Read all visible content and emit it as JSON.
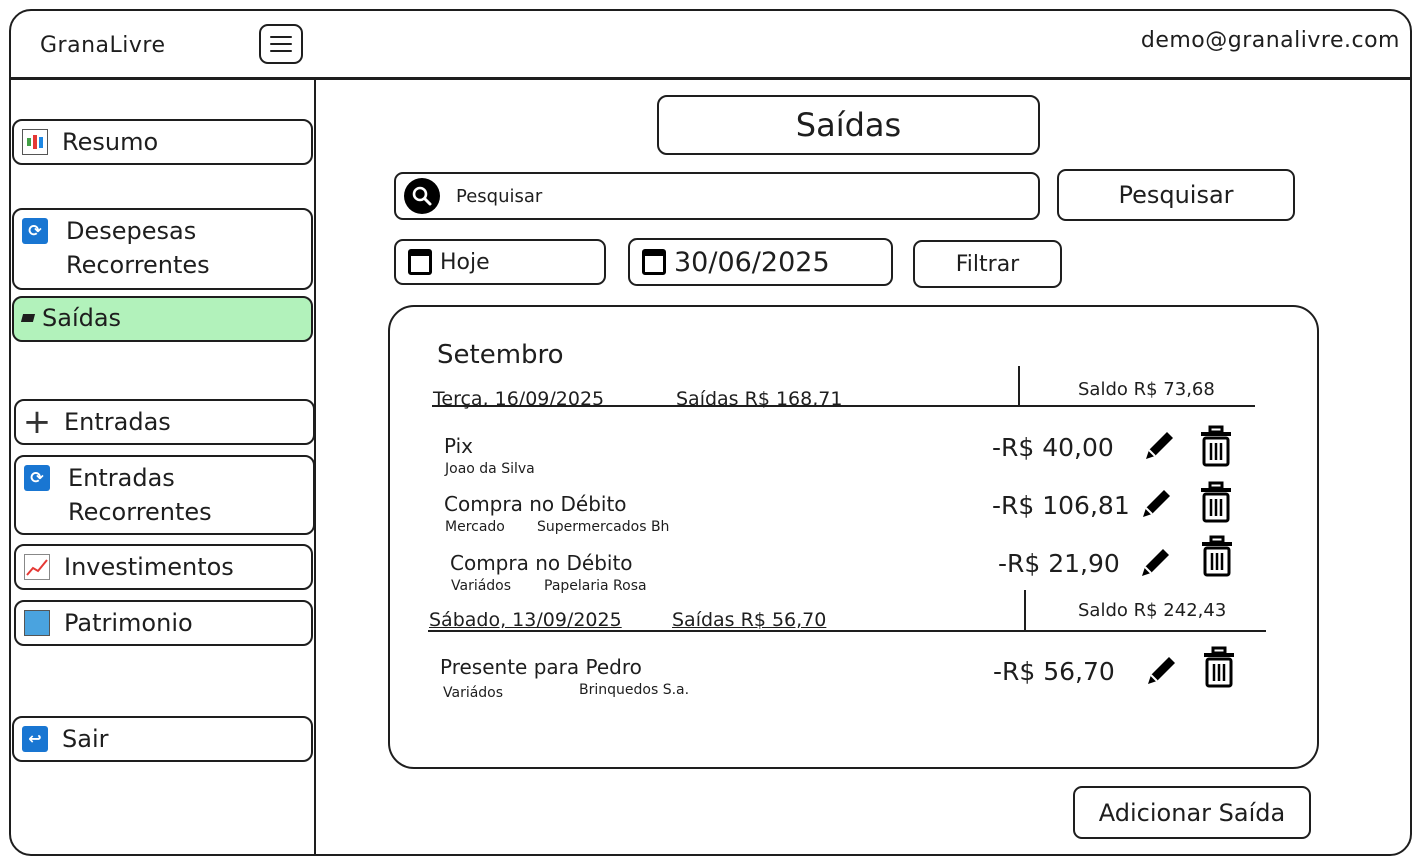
{
  "app": {
    "title": "GranaLivre",
    "user_email": "demo@granalivre.com"
  },
  "sidebar": {
    "items": [
      {
        "label": "Resumo",
        "icon": "bar-chart-icon"
      },
      {
        "label": "Desepesas\nRecorrentes",
        "icon": "recurring-icon"
      },
      {
        "label": "Saídas",
        "icon": "expense-icon",
        "active": true
      },
      {
        "label": "Entradas",
        "icon": "plus-icon"
      },
      {
        "label": "Entradas\nRecorrentes",
        "icon": "recurring-icon"
      },
      {
        "label": "Investimentos",
        "icon": "trend-chart-icon"
      },
      {
        "label": "Patrimonio",
        "icon": "building-icon"
      },
      {
        "label": "Sair",
        "icon": "exit-icon"
      }
    ]
  },
  "main": {
    "title": "Saídas",
    "search": {
      "placeholder": "Pesquisar",
      "button_label": "Pesquisar"
    },
    "filter": {
      "start_label": "Hoje",
      "end_value": "30/06/2025",
      "button_label": "Filtrar"
    },
    "month": "Setembro",
    "days": [
      {
        "date": "Terça, 16/09/2025",
        "out": "Saídas R$ 168,71",
        "saldo": "Saldo R$ 73,68",
        "transactions": [
          {
            "title": "Pix",
            "category": "Joao da Silva",
            "merchant": "",
            "amount": "-R$ 40,00"
          },
          {
            "title": "Compra no Débito",
            "category": "Mercado",
            "merchant": "Supermercados Bh",
            "amount": "-R$ 106,81"
          },
          {
            "title": "Compra no Débito",
            "category": "Variádos",
            "merchant": "Papelaria Rosa",
            "amount": "-R$ 21,90"
          }
        ]
      },
      {
        "date": "Sábado, 13/09/2025",
        "out": "Saídas R$ 56,70",
        "saldo": "Saldo R$ 242,43",
        "transactions": [
          {
            "title": "Presente para Pedro",
            "category": "Variádos",
            "merchant": "Brinquedos S.a.",
            "amount": "-R$ 56,70"
          }
        ]
      }
    ],
    "add_button_label": "Adicionar Saída"
  },
  "colors": {
    "active_nav": "#b2f2bb",
    "icon_blue": "#1976d2",
    "stroke": "#1e1e1e"
  }
}
